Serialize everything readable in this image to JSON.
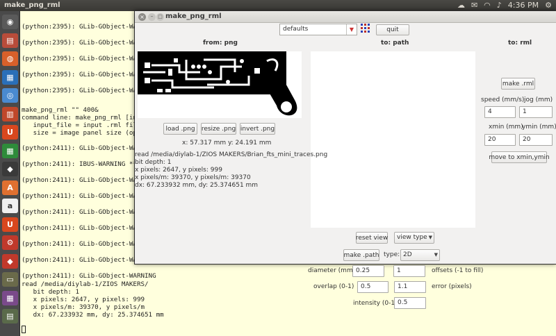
{
  "top_panel": {
    "title": "make_png_rml",
    "time": "4:36 PM",
    "icons": [
      "cloud-icon",
      "mail-icon",
      "wifi-icon",
      "volume-icon",
      "gear-icon"
    ]
  },
  "launcher": {
    "items": [
      {
        "name": "dash-icon",
        "glyph": "◉",
        "color": "#5a5a5a"
      },
      {
        "name": "files-icon",
        "glyph": "▤",
        "color": "#b84c3a"
      },
      {
        "name": "firefox-icon",
        "glyph": "◍",
        "color": "#d8602a"
      },
      {
        "name": "writer-icon",
        "glyph": "▦",
        "color": "#2a6fb8"
      },
      {
        "name": "chromium-icon",
        "glyph": "◎",
        "color": "#4a8ad0"
      },
      {
        "name": "impress-icon",
        "glyph": "▥",
        "color": "#c0472a"
      },
      {
        "name": "ubuntu-one-icon",
        "glyph": "U",
        "color": "#d8471e"
      },
      {
        "name": "calc-icon",
        "glyph": "▦",
        "color": "#2e8b3a"
      },
      {
        "name": "inkscape-icon",
        "glyph": "◆",
        "color": "#3a3a3a"
      },
      {
        "name": "software-center-icon",
        "glyph": "A",
        "color": "#e07030"
      },
      {
        "name": "amazon-icon",
        "glyph": "a",
        "color": "#f0f0f0"
      },
      {
        "name": "ubuntu-software-icon",
        "glyph": "U",
        "color": "#d8471e"
      },
      {
        "name": "settings-icon",
        "glyph": "⚙",
        "color": "#c0392b"
      },
      {
        "name": "ruby-icon",
        "glyph": "◆",
        "color": "#c0392b"
      },
      {
        "name": "terminal-icon",
        "glyph": "▭",
        "color": "#6a6a4a"
      },
      {
        "name": "workspace-icon",
        "glyph": "▦",
        "color": "#7a4a8a"
      },
      {
        "name": "trash-icon",
        "glyph": "▤",
        "color": "#5a6a4a"
      }
    ]
  },
  "terminal": {
    "lines": [
      "(python:2395): GLib-GObject-WARNING",
      "(python:2395): GLib-GObject-WARNING",
      "(python:2395): GLib-GObject-WARNING",
      "(python:2395): GLib-GObject-WARNING",
      "(python:2395): GLib-GObject-WARNING",
      "make_png_rml \"\" 400&",
      "command line: make_png_rml [input",
      "   input_file = input .rml file",
      "   size = image panel size (opt",
      "(python:2411): GLib-GObject-WARNING",
      "(python:2411): IBUS-WARNING **: U",
      "(python:2411): GLib-GObject-WARNING",
      "(python:2411): GLib-GObject-WARNING",
      "(python:2411): GLib-GObject-WARNING",
      "(python:2411): GLib-GObject-WARNING",
      "(python:2411): GLib-GObject-WARNING",
      "(python:2411): GLib-GObject-WARNING",
      "(python:2411): GLib-GObject-WARNING",
      "read /media/diylab-1/ZIOS MAKERS/",
      "   bit depth: 1",
      "   x pixels: 2647, y pixels: 999",
      "   x pixels/m: 39370, y pixels/m",
      "   dx: 67.233932 mm, dy: 25.374651 mm"
    ]
  },
  "app": {
    "title": "make_png_rml",
    "defaults_value": "defaults",
    "quit_label": "quit",
    "from_png_header": "from: png",
    "to_path_header": "to: path",
    "to_rml_header": "to: rml",
    "load_png_label": "load .png",
    "resize_png_label": "resize .png",
    "invert_png_label": "invert .png",
    "xy_readout": "x: 57.317 mm  y: 24.191 mm",
    "info": {
      "read": "read /media/diylab-1/ZIOS MAKERS/Brian_fts_mini_traces.png",
      "bit_depth": " bit depth: 1",
      "pixels": " x pixels: 2647, y pixels: 999",
      "pixels_m": " x pixels/m: 39370, y pixels/m: 39370",
      "dxdy": " dx: 67.233932 mm, dy: 25.374651 mm"
    },
    "make_rml_label": "make .rml",
    "speed_label": "speed (mm/s)",
    "jog_label": "jog (mm)",
    "speed_value": "4",
    "jog_value": "1",
    "xmin_label": "xmin (mm)",
    "ymin_label": "ymin (mm)",
    "xmin_value": "20",
    "ymin_value": "20",
    "move_label": "move to xmin,ymin",
    "reset_view_label": "reset view",
    "view_type_label": "view type",
    "make_path_label": "make .path",
    "type_label": "type:",
    "type_value": "2D",
    "diameter_label": "diameter (mm)",
    "diameter_value": "0.25",
    "offsets_value": "1",
    "offsets_label": "offsets (-1 to fill)",
    "overlap_label": "overlap (0-1)",
    "overlap_value": "0.5",
    "error_value": "1.1",
    "error_label": "error (pixels)",
    "intensity_label": "intensity (0-1)",
    "intensity_value": "0.5"
  }
}
